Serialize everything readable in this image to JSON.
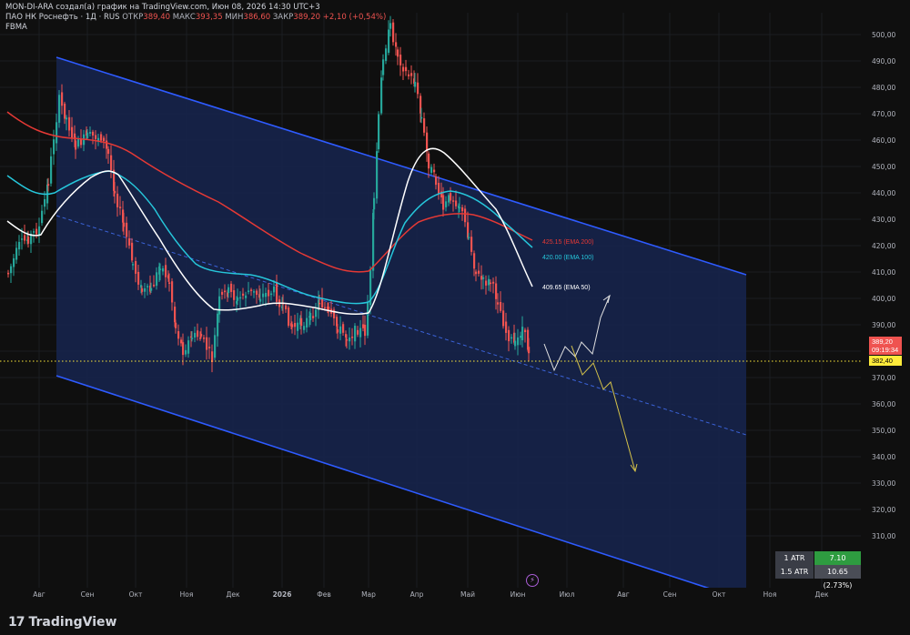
{
  "header": {
    "line1_prefix": "MON-DI-ARA создал(а) график на TradingView.com, Июн 08, 2026 14:30 UTC+3",
    "symbol": "ПАО НК Роснефть · 1Д · RUS",
    "open_label": "ОТКР",
    "open": "389,40",
    "high_label": "МАКС",
    "high": "393,35",
    "low_label": "МИН",
    "low": "386,60",
    "close_label": "ЗАКР",
    "close": "389,20",
    "change": "+2,10 (+0,54%)",
    "indicator": "FBMA"
  },
  "price_axis": [
    "500,00",
    "490,00",
    "480,00",
    "470,00",
    "460,00",
    "450,00",
    "440,00",
    "430,00",
    "420,00",
    "410,00",
    "400,00",
    "390,00",
    "380,00",
    "370,00",
    "360,00",
    "350,00",
    "340,00",
    "330,00",
    "320,00",
    "310,00"
  ],
  "time_axis": [
    "Авг",
    "Сен",
    "Окт",
    "Ноя",
    "Дек",
    "2026",
    "Фев",
    "Мар",
    "Апр",
    "Май",
    "Июн",
    "Июл",
    "Авг",
    "Сен",
    "Окт",
    "Ноя",
    "Дек"
  ],
  "ema_labels": [
    {
      "text": "425.15 (EMA 200)",
      "color": "#e53935"
    },
    {
      "text": "420.00 (EMA 100)",
      "color": "#26c6da"
    },
    {
      "text": "409.65 (EMA 50)",
      "color": "#ffffff"
    }
  ],
  "price_tags": {
    "last_price": "389,20",
    "countdown": "09:19:34",
    "level": "382,40"
  },
  "atr": [
    {
      "label": "1 ATR",
      "value": "7.10 (1.82%)"
    },
    {
      "label": "1.5 ATR",
      "value": "10.65 (2.73%)"
    }
  ],
  "brand": "TradingView",
  "colors": {
    "up": "#26a69a",
    "down": "#ef5350",
    "channel": "#2962ff",
    "ema200": "#e53935",
    "ema100": "#26c6da",
    "ema50": "#ffffff",
    "level": "#ffeb3b"
  }
}
